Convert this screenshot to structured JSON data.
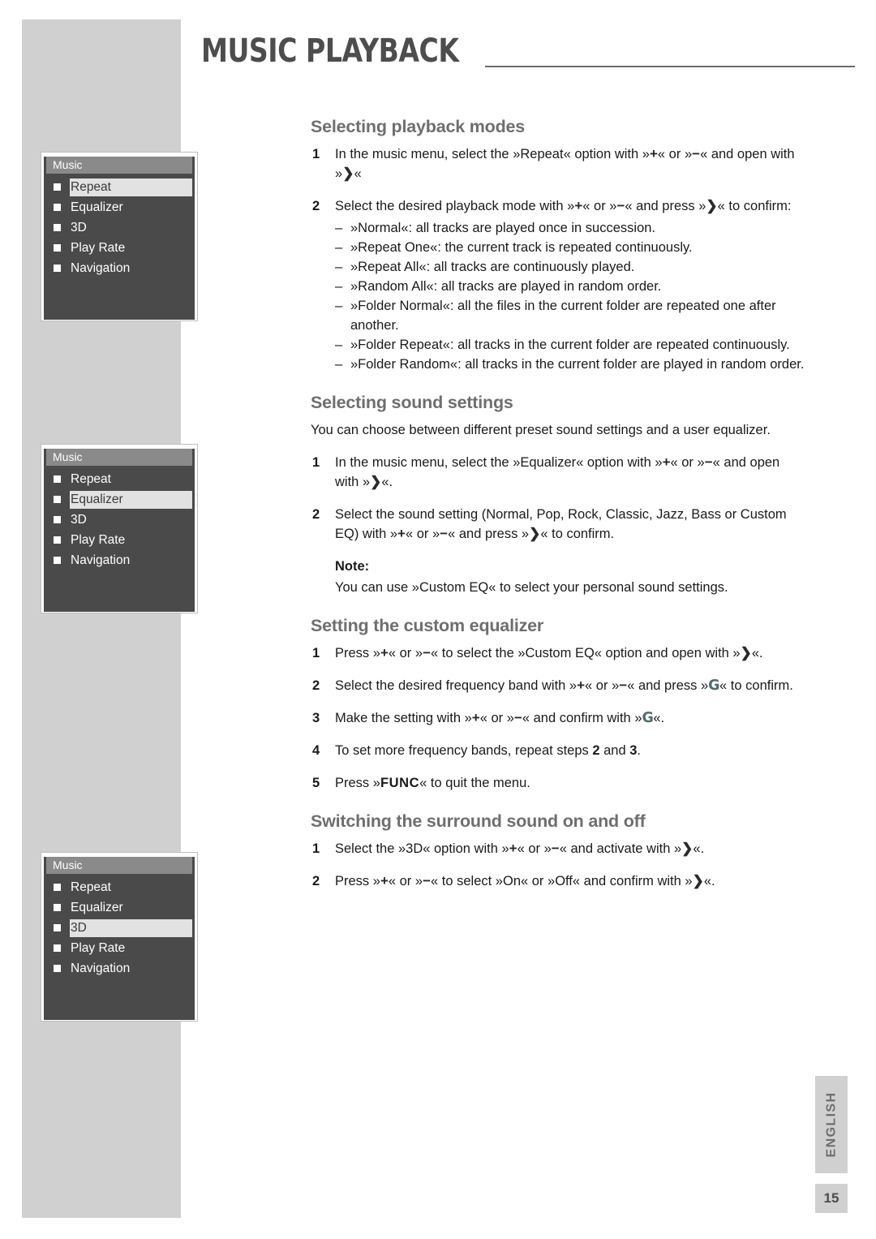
{
  "header": {
    "title": "MUSIC PLAYBACK"
  },
  "footer": {
    "language_tab": "ENGLISH",
    "page_number": "15"
  },
  "colors": {
    "band": "#d0d0d0",
    "heading": "#6e6e6e",
    "title": "#4d4d4d",
    "osd_background": "#4a4a4a",
    "osd_titlebar": "#8a8a8a",
    "osd_selected": "#e2e2e2",
    "key_g": "#4f6d6d"
  },
  "osd_menus": [
    {
      "title": "Music",
      "items": [
        {
          "label": "Repeat",
          "selected": true
        },
        {
          "label": "Equalizer",
          "selected": false
        },
        {
          "label": "3D",
          "selected": false
        },
        {
          "label": "Play Rate",
          "selected": false
        },
        {
          "label": "Navigation",
          "selected": false
        }
      ]
    },
    {
      "title": "Music",
      "items": [
        {
          "label": "Repeat",
          "selected": false
        },
        {
          "label": "Equalizer",
          "selected": true
        },
        {
          "label": "3D",
          "selected": false
        },
        {
          "label": "Play Rate",
          "selected": false
        },
        {
          "label": "Navigation",
          "selected": false
        }
      ]
    },
    {
      "title": "Music",
      "items": [
        {
          "label": "Repeat",
          "selected": false
        },
        {
          "label": "Equalizer",
          "selected": false
        },
        {
          "label": "3D",
          "selected": true
        },
        {
          "label": "Play Rate",
          "selected": false
        },
        {
          "label": "Navigation",
          "selected": false
        }
      ]
    }
  ],
  "sections": {
    "playback_modes": {
      "heading": "Selecting playback modes",
      "step1": {
        "num": "1",
        "a": "In the music menu, select the »Repeat« option with »",
        "plus": "+",
        "b": "« or »",
        "minus": "−",
        "c": "« and open with »",
        "arrow": "❯",
        "d": "«"
      },
      "step2": {
        "num": "2",
        "a": "Select the desired playback mode with »",
        "plus": "+",
        "b": "« or »",
        "minus": "−",
        "c": "« and press »",
        "arrow": "❯",
        "d": "« to confirm:",
        "modes": [
          "»Normal«: all tracks are played once in succession.",
          "»Repeat One«: the current track is repeated continuously.",
          "»Repeat All«: all tracks are continuously played.",
          "»Random All«: all tracks are played in random order.",
          "»Folder Normal«: all the files in the current folder are repeated one after another.",
          "»Folder Repeat«: all tracks in the current folder are repeated continuously.",
          "»Folder Random«: all tracks in the current folder are played in random order."
        ]
      }
    },
    "sound_settings": {
      "heading": "Selecting sound settings",
      "intro": "You can choose between different preset sound settings and a user equalizer.",
      "step1": {
        "num": "1",
        "a": "In the music menu, select the »Equalizer« option with »",
        "plus": "+",
        "b": "« or »",
        "minus": "−",
        "c": "« and open with »",
        "arrow": "❯",
        "d": "«."
      },
      "step2": {
        "num": "2",
        "a": "Select the sound setting (Normal, Pop, Rock, Classic, Jazz, Bass or Custom EQ) with »",
        "plus": "+",
        "b": "« or »",
        "minus": "−",
        "c": "« and press »",
        "arrow": "❯",
        "d": "« to confirm."
      },
      "note_label": "Note:",
      "note_text": "You can use »Custom EQ« to select your personal sound settings."
    },
    "custom_equalizer": {
      "heading": "Setting the custom equalizer",
      "step1": {
        "num": "1",
        "a": "Press »",
        "plus": "+",
        "b": "« or »",
        "minus": "−",
        "c": "« to select the »Custom EQ« option and open with »",
        "arrow": "❯",
        "d": "«."
      },
      "step2": {
        "num": "2",
        "a": "Select the desired frequency band with »",
        "plus": "+",
        "b": "« or »",
        "minus": "−",
        "c": "« and press »",
        "g": "G",
        "d": "« to confirm."
      },
      "step3": {
        "num": "3",
        "a": "Make the setting with »",
        "plus": "+",
        "b": "« or »",
        "minus": "−",
        "c": "« and confirm with »",
        "g": "G",
        "d": "«."
      },
      "step4": {
        "num": "4",
        "a": "To set more frequency bands, repeat steps ",
        "b": "2",
        "c": " and ",
        "d": "3",
        "e": "."
      },
      "step5": {
        "num": "5",
        "a": "Press »",
        "func": "FUNC",
        "b": "« to quit the menu."
      }
    },
    "surround": {
      "heading": "Switching the surround sound on and off",
      "step1": {
        "num": "1",
        "a": "Select the »3D« option with »",
        "plus": "+",
        "b": "« or »",
        "minus": "−",
        "c": "« and activate with »",
        "arrow": "❯",
        "d": "«."
      },
      "step2": {
        "num": "2",
        "a": "Press »",
        "plus": "+",
        "b": "« or »",
        "minus": "−",
        "c": "« to select »On« or »Off« and confirm with »",
        "arrow": "❯",
        "d": "«."
      }
    }
  }
}
